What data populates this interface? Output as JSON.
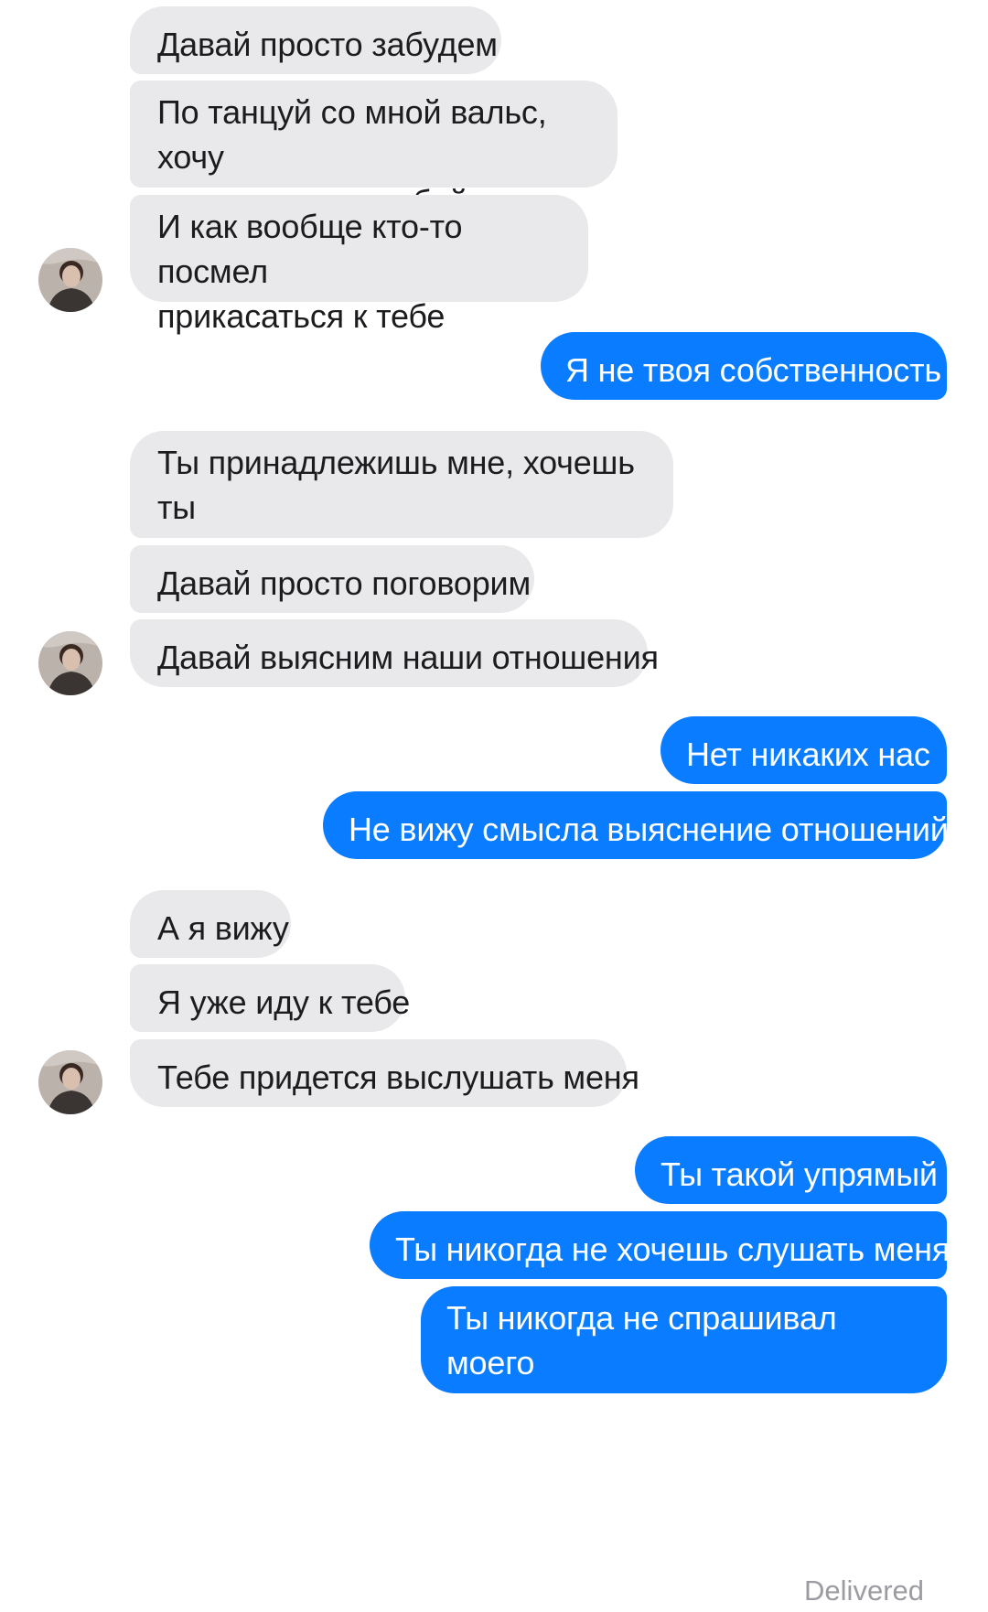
{
  "conversation": {
    "messages": [
      {
        "sender": "them",
        "text": "Давай просто забудем"
      },
      {
        "sender": "them",
        "text": "По танцуй со мной вальс, хочу\nпотанцевать с тобой"
      },
      {
        "sender": "them",
        "text": "И как вообще кто-то посмел\nприкасаться к тебе"
      },
      {
        "sender": "me",
        "text": "Я не твоя собственность"
      },
      {
        "sender": "them",
        "text": "Ты принадлежишь мне, хочешь ты\nэтого или нет"
      },
      {
        "sender": "them",
        "text": "Давай просто поговорим"
      },
      {
        "sender": "them",
        "text": "Давай выясним наши отношения"
      },
      {
        "sender": "me",
        "text": "Нет никаких нас"
      },
      {
        "sender": "me",
        "text": "Не вижу смысла выяснение отношений"
      },
      {
        "sender": "them",
        "text": "А я вижу"
      },
      {
        "sender": "them",
        "text": "Я уже иду к тебе"
      },
      {
        "sender": "them",
        "text": "Тебе придется выслушать меня"
      },
      {
        "sender": "me",
        "text": "Ты такой упрямый"
      },
      {
        "sender": "me",
        "text": "Ты никогда не хочешь слушать меня"
      },
      {
        "sender": "me",
        "text": "Ты никогда не спрашивал моего\nмнения"
      }
    ],
    "status": "Delivered"
  },
  "colors": {
    "incoming_bubble": "#e9e9eb",
    "outgoing_bubble": "#0a7cff",
    "incoming_text": "#1c1c1e",
    "outgoing_text": "#ffffff",
    "status_text": "#9b9ba1"
  },
  "icons": {
    "avatar": "contact-avatar-icon"
  }
}
